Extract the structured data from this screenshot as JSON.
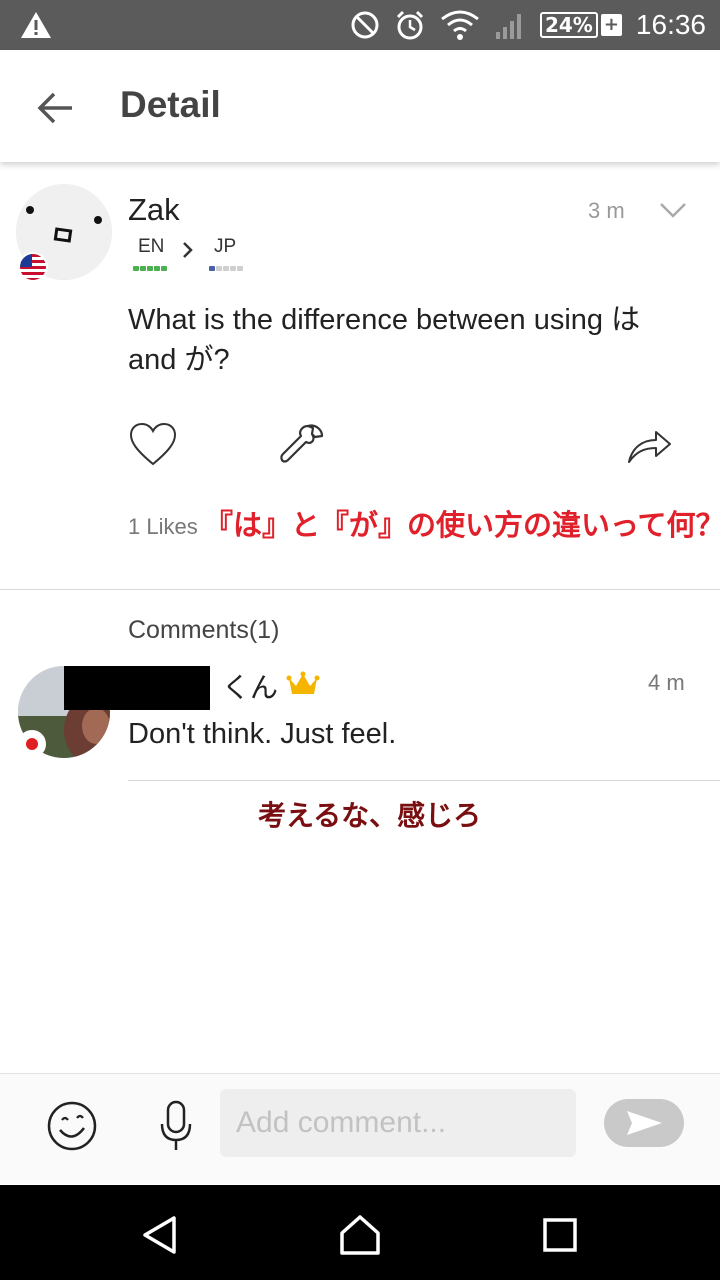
{
  "status_bar": {
    "battery": "24%",
    "battery_plus": "+",
    "time": "16:36"
  },
  "app_bar": {
    "title": "Detail"
  },
  "post": {
    "username": "Zak",
    "time": "3 m",
    "native_language": "EN",
    "learning_language": "JP",
    "text": "What is the difference between using は and が?",
    "likes": "1 Likes",
    "annotation_jp": "『は』と『が』の使い方の違いって何？"
  },
  "comments": {
    "title": "Comments(1)",
    "items": [
      {
        "name_suffix": "くん",
        "time": "4 m",
        "text": "Don't think. Just feel.",
        "annotation_jp": "考えるな、感じろ"
      }
    ]
  },
  "input_bar": {
    "placeholder": "Add comment..."
  },
  "colors": {
    "status_bar": "#5b5b5b",
    "annotation_red": "#e0202a",
    "annotation_dark_red": "#7a0f12",
    "level_green": "#4caf50",
    "level_blue": "#4a5fa8"
  }
}
